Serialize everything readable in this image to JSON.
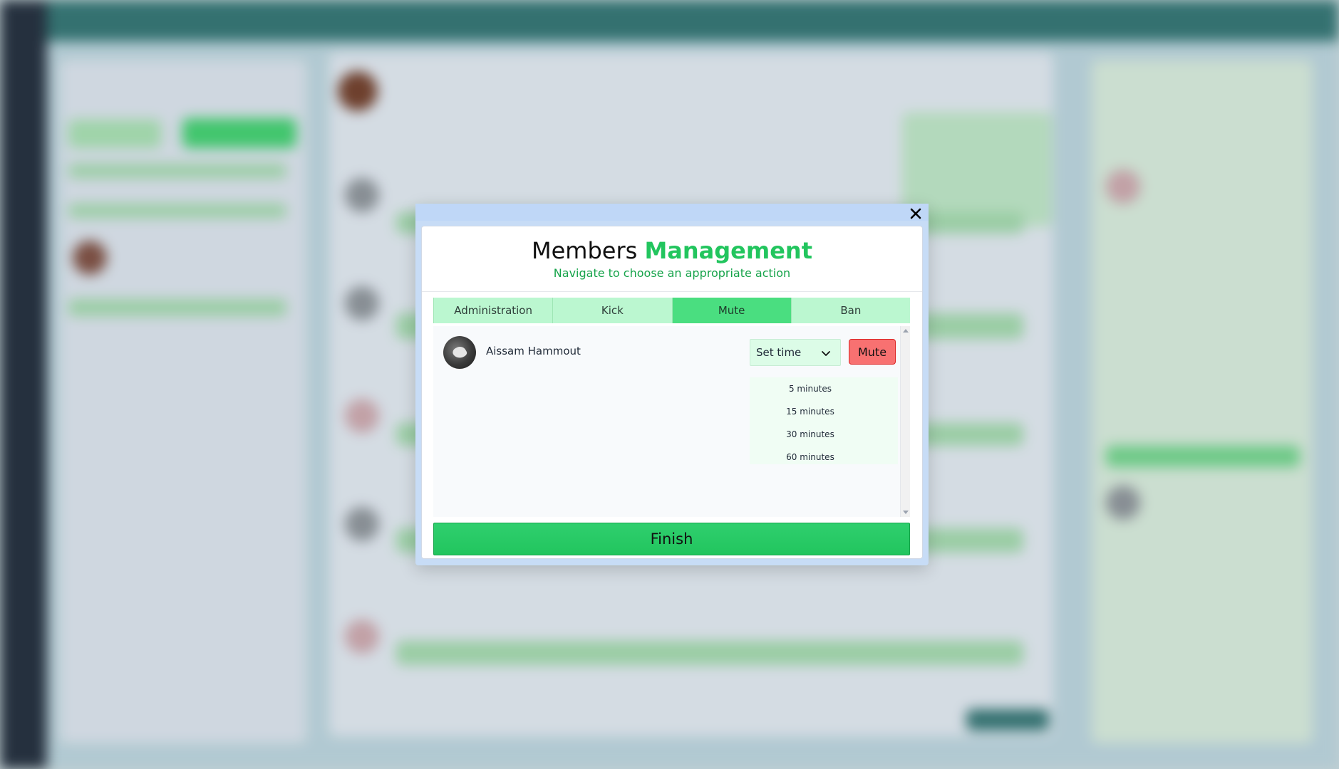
{
  "modal": {
    "title_plain": "Members",
    "title_accent": "Management",
    "subtitle": "Navigate to choose an appropriate action",
    "tabs": [
      {
        "label": "Administration",
        "active": false
      },
      {
        "label": "Kick",
        "active": false
      },
      {
        "label": "Mute",
        "active": true
      },
      {
        "label": "Ban",
        "active": false
      }
    ],
    "member": {
      "name": "Aissam Hammout"
    },
    "time_select": {
      "selected": "Set time",
      "options": [
        "5 minutes",
        "15 minutes",
        "30 minutes",
        "60 minutes"
      ]
    },
    "mute_button": "Mute",
    "finish_button": "Finish",
    "close_icon": "close-icon"
  },
  "colors": {
    "accent_green": "#22c55e",
    "tab_bg": "#bbf7d0",
    "tab_active": "#4ade80",
    "mute_red": "#f87171",
    "modal_frame": "#c7dcf6"
  }
}
